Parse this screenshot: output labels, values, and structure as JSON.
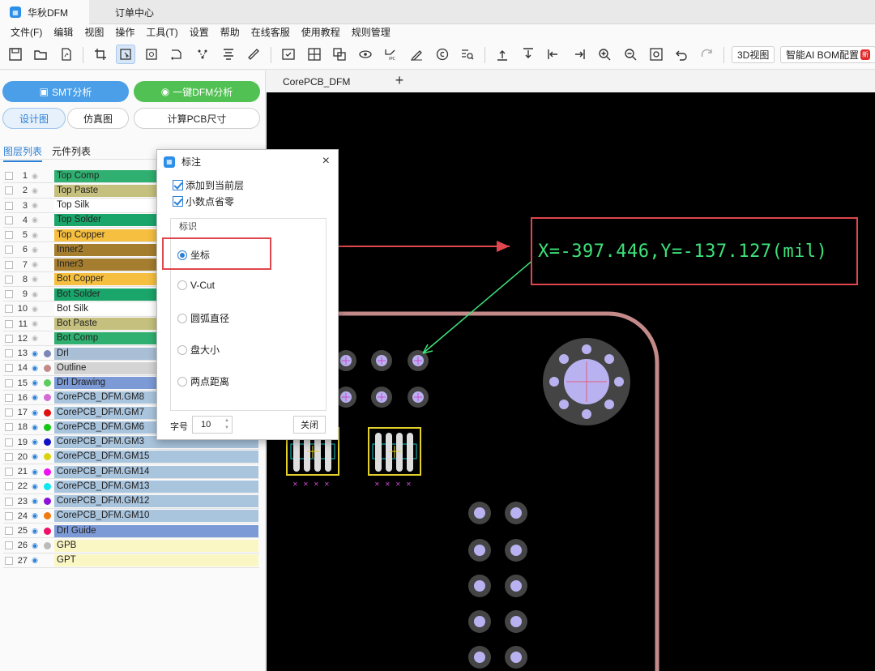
{
  "app": {
    "title_tab": "华秋DFM",
    "second_tab": "订单中心"
  },
  "menu": [
    "文件(F)",
    "编辑",
    "视图",
    "操作",
    "工具(T)",
    "设置",
    "帮助",
    "在线客服",
    "使用教程",
    "规则管理"
  ],
  "toolbar": {
    "view3d_label": "3D视图",
    "ai_bom_label": "智能AI BOM配置",
    "new_badge": "新"
  },
  "left_panel": {
    "smt_button": "SMT分析",
    "dfm_button": "一键DFM分析",
    "design_button": "设计图",
    "sim_button": "仿真图",
    "calc_button": "计算PCB尺寸",
    "tab_layers": "图层列表",
    "tab_components": "元件列表"
  },
  "layers": [
    {
      "num": "1",
      "name": "Top Comp",
      "color": "#2fb070",
      "dot": ""
    },
    {
      "num": "2",
      "name": "Top Paste",
      "color": "#c5c07d",
      "dot": ""
    },
    {
      "num": "3",
      "name": "Top Silk",
      "color": "#ffffff",
      "dot": ""
    },
    {
      "num": "4",
      "name": "Top Solder",
      "color": "#1aa56a",
      "dot": ""
    },
    {
      "num": "5",
      "name": "Top Copper",
      "color": "#f6bf3f",
      "dot": ""
    },
    {
      "num": "6",
      "name": "Inner2",
      "color": "#a57d2f",
      "dot": ""
    },
    {
      "num": "7",
      "name": "Inner3",
      "color": "#a57d2f",
      "dot": ""
    },
    {
      "num": "8",
      "name": "Bot Copper",
      "color": "#f6bf3f",
      "dot": ""
    },
    {
      "num": "9",
      "name": "Bot Solder",
      "color": "#1aa56a",
      "dot": ""
    },
    {
      "num": "10",
      "name": "Bot Silk",
      "color": "#ffffff",
      "dot": ""
    },
    {
      "num": "11",
      "name": "Bot Paste",
      "color": "#c5c07d",
      "dot": ""
    },
    {
      "num": "12",
      "name": "Bot Comp",
      "color": "#2fb070",
      "dot": ""
    },
    {
      "num": "13",
      "name": "Drl",
      "color": "#a9bfd6",
      "dot": "#7a86b6"
    },
    {
      "num": "14",
      "name": "Outline",
      "color": "#d4d4d4",
      "dot": "#c48a8a"
    },
    {
      "num": "15",
      "name": "Drl Drawing",
      "color": "#7b9ad6",
      "dot": "#5ccc5c"
    },
    {
      "num": "16",
      "name": "CorePCB_DFM.GM8",
      "color": "#a9c4dd",
      "dot": "#d46bd4"
    },
    {
      "num": "17",
      "name": "CorePCB_DFM.GM7",
      "color": "#a9c4dd",
      "dot": "#e01010"
    },
    {
      "num": "18",
      "name": "CorePCB_DFM.GM6",
      "color": "#a9c4dd",
      "dot": "#17c717"
    },
    {
      "num": "19",
      "name": "CorePCB_DFM.GM3",
      "color": "#a9c4dd",
      "dot": "#1010c7"
    },
    {
      "num": "20",
      "name": "CorePCB_DFM.GM15",
      "color": "#a9c4dd",
      "dot": "#d9d40f"
    },
    {
      "num": "21",
      "name": "CorePCB_DFM.GM14",
      "color": "#a9c4dd",
      "dot": "#f010f0"
    },
    {
      "num": "22",
      "name": "CorePCB_DFM.GM13",
      "color": "#a9c4dd",
      "dot": "#10e8f0"
    },
    {
      "num": "23",
      "name": "CorePCB_DFM.GM12",
      "color": "#a9c4dd",
      "dot": "#8e10d9"
    },
    {
      "num": "24",
      "name": "CorePCB_DFM.GM10",
      "color": "#a9c4dd",
      "dot": "#f07a10"
    },
    {
      "num": "25",
      "name": "Drl Guide",
      "color": "#7b9ad6",
      "dot": "#f0106a"
    },
    {
      "num": "26",
      "name": "GPB",
      "color": "#fbf7c4",
      "dot": "#bbbbbb"
    },
    {
      "num": "27",
      "name": "GPT",
      "color": "#fbf7c4",
      "dot": ""
    }
  ],
  "document": {
    "tab_name": "CorePCB_DFM",
    "add_tab": "+"
  },
  "dialog": {
    "title": "标注",
    "close": "×",
    "add_to_layer": "添加到当前层",
    "omit_zero": "小数点省零",
    "group_title": "标识",
    "options": [
      "坐标",
      "V-Cut",
      "圆弧直径",
      "盘大小",
      "两点距离"
    ],
    "selected_option": "坐标",
    "font_size_label": "字号",
    "font_size_value": "10",
    "close_button": "关闭"
  },
  "annotation": {
    "coordinate_text": "X=-397.446,Y=-137.127(mil)"
  }
}
